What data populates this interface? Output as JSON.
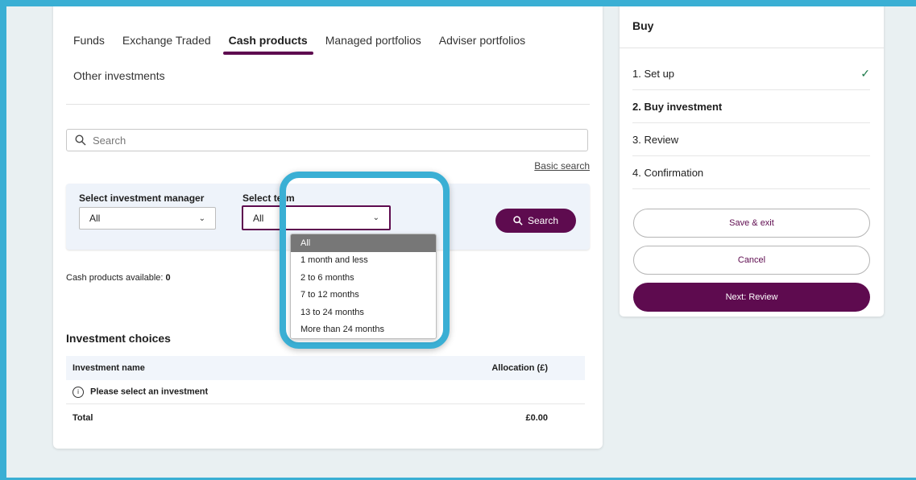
{
  "colors": {
    "accent": "#5e0b4f",
    "highlight": "#3aafd4",
    "panel": "#eef3fa"
  },
  "tabs": [
    {
      "label": "Funds"
    },
    {
      "label": "Exchange Traded"
    },
    {
      "label": "Cash products"
    },
    {
      "label": "Managed portfolios"
    },
    {
      "label": "Adviser portfolios"
    },
    {
      "label": "Other investments"
    }
  ],
  "active_tab": "Cash products",
  "search": {
    "placeholder": "Search",
    "icon": "search-icon"
  },
  "basic_search_label": "Basic search",
  "filters": {
    "manager_label": "Select investment manager",
    "manager_value": "All",
    "term_label": "Select term",
    "term_value": "All",
    "search_button": "Search",
    "term_options": [
      "All",
      "1 month and less",
      "2 to 6 months",
      "7 to 12 months",
      "13 to 24 months",
      "More than 24 months"
    ]
  },
  "available": {
    "label": "Cash products available:",
    "count": "0"
  },
  "choices": {
    "title": "Investment choices",
    "col_name": "Investment name",
    "col_alloc": "Allocation (£)",
    "empty_message": "Please select an investment",
    "total_label": "Total",
    "total_value": "£0.00"
  },
  "sidebar": {
    "title": "Buy",
    "steps": [
      {
        "label": "1. Set up",
        "done": true
      },
      {
        "label": "2. Buy investment",
        "current": true
      },
      {
        "label": "3. Review"
      },
      {
        "label": "4. Confirmation"
      }
    ],
    "save_exit": "Save & exit",
    "cancel": "Cancel",
    "next": "Next: Review"
  }
}
